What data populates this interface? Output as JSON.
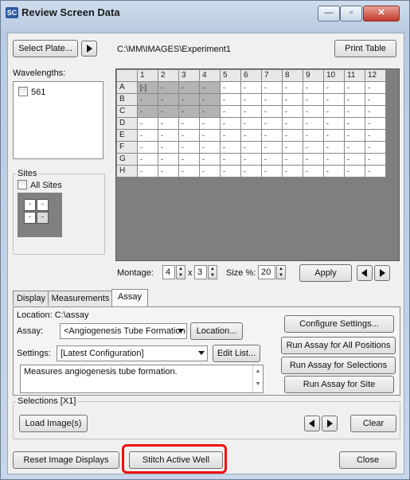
{
  "window": {
    "title": "Review Screen Data",
    "icon_label": "SC",
    "min_symbol": "—",
    "max_symbol": "▫",
    "close_symbol": "✕"
  },
  "toolbar": {
    "select_plate_label": "Select Plate...",
    "path": "C:\\MM\\IMAGES\\Experiment1",
    "print_table_label": "Print Table"
  },
  "wavelengths": {
    "label": "Wavelengths:",
    "items": [
      {
        "label": "561",
        "checked": false
      }
    ]
  },
  "sites": {
    "label": "Sites",
    "all_sites_label": "All Sites",
    "cells": [
      "-",
      "-",
      "-",
      "-"
    ]
  },
  "plate": {
    "columns": [
      "1",
      "2",
      "3",
      "4",
      "5",
      "6",
      "7",
      "8",
      "9",
      "10",
      "11",
      "12"
    ],
    "rows": [
      "A",
      "B",
      "C",
      "D",
      "E",
      "F",
      "G",
      "H"
    ],
    "first_cell": "[-]",
    "empty_cell": "-"
  },
  "montage": {
    "label": "Montage:",
    "cols": "4",
    "x_label": "x",
    "rows": "3",
    "size_label": "Size %:",
    "size_value": "20",
    "apply_label": "Apply"
  },
  "tabs": [
    {
      "label": "Display",
      "active": false
    },
    {
      "label": "Measurements",
      "active": false
    },
    {
      "label": "Assay",
      "active": true
    }
  ],
  "assay_tab": {
    "location_text": "Location: C:\\assay",
    "assay_label": "Assay:",
    "assay_value": "<Angiogenesis Tube Formation",
    "location_button": "Location...",
    "settings_label": "Settings:",
    "settings_value": "[Latest Configuration]",
    "edit_list_button": "Edit List...",
    "description": "Measures angiogenesis tube formation.",
    "configure_button": "Configure Settings...",
    "run_all_button": "Run Assay for All Positions",
    "run_selections_button": "Run Assay for Selections",
    "run_site_button": "Run Assay for Site"
  },
  "selections": {
    "label": "Selections [X1]",
    "load_images_button": "Load Image(s)",
    "clear_button": "Clear"
  },
  "footer": {
    "reset_button": "Reset Image Displays",
    "stitch_button": "Stitch Active Well",
    "close_button": "Close"
  },
  "colors": {
    "highlight": "#ee1111",
    "close_button": "#c0392b"
  }
}
